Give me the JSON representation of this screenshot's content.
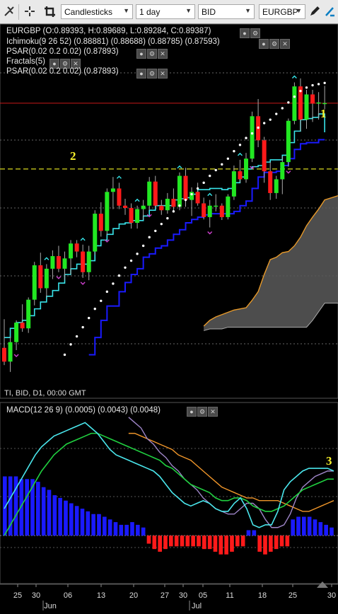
{
  "toolbar": {
    "chart_type": "Candlesticks",
    "period": "1 day",
    "side": "BID",
    "symbol": "EURGBP",
    "icons": [
      "tools-icon",
      "crosshair-icon",
      "crop-icon",
      "pencil-icon",
      "eraser-icon"
    ]
  },
  "legend": {
    "ohlc": "EURGBP (O:0.89393, H:0.89689, L:0.89284, C:0.89387)",
    "ichimoku": "Ichimoku(9 26 52) (0.88881) (0.88688) (0.88785) (0.87593)",
    "psar1": "PSAR(0.02 0.2 0.02) (0.87893)",
    "fractals": "Fractals(5)",
    "psar2": "PSAR(0.02 0.2 0.02) (0.87893)"
  },
  "footer_label": "TI, BID, D1, 00:00 GMT",
  "macd_label": "MACD(12 26 9) (0.0005) (0.0043) (0.0048)",
  "annotations": [
    "1",
    "2",
    "3"
  ],
  "x_axis": {
    "day_labels": [
      "25",
      "30",
      "06",
      "13",
      "20",
      "27",
      "30",
      "05",
      "11",
      "18",
      "25",
      "30"
    ],
    "month_labels": [
      "Jun",
      "Jul"
    ]
  },
  "colors": {
    "bull": "#22e822",
    "bear": "#ff1a1a",
    "tenkan": "#39e4ea",
    "kijun": "#1a1aff",
    "psar": "#ffffff",
    "cloud": "#5a5a5a",
    "span_b": "#e89a2a",
    "hline": "#c81818",
    "macd": "#4ae6ec",
    "signal": "#20d040",
    "macd_b": "#f0962a",
    "macd_c": "#9f86c9",
    "hist_pos": "#1a1aff",
    "hist_neg": "#ff1a1a"
  },
  "chart_data": {
    "type": "candlestick",
    "title": "EURGBP",
    "price_range": [
      0.845,
      0.902
    ],
    "candles": [
      [
        0.8512,
        0.8562,
        0.8482,
        0.8488
      ],
      [
        0.8488,
        0.8532,
        0.847,
        0.8522
      ],
      [
        0.8522,
        0.856,
        0.8508,
        0.8556
      ],
      [
        0.8556,
        0.8588,
        0.854,
        0.8546
      ],
      [
        0.8546,
        0.86,
        0.8538,
        0.8596
      ],
      [
        0.8596,
        0.8662,
        0.8586,
        0.8656
      ],
      [
        0.8656,
        0.8678,
        0.8608,
        0.8616
      ],
      [
        0.8616,
        0.8658,
        0.86,
        0.865
      ],
      [
        0.865,
        0.8682,
        0.8632,
        0.8672
      ],
      [
        0.8672,
        0.869,
        0.8644,
        0.865
      ],
      [
        0.865,
        0.868,
        0.863,
        0.8668
      ],
      [
        0.8668,
        0.87,
        0.864,
        0.8694
      ],
      [
        0.8694,
        0.87,
        0.867,
        0.868
      ],
      [
        0.868,
        0.8692,
        0.8634,
        0.8644
      ],
      [
        0.8644,
        0.869,
        0.863,
        0.868
      ],
      [
        0.868,
        0.8752,
        0.8674,
        0.8746
      ],
      [
        0.8746,
        0.8766,
        0.8706,
        0.8716
      ],
      [
        0.8716,
        0.879,
        0.8708,
        0.8784
      ],
      [
        0.8784,
        0.881,
        0.8754,
        0.879
      ],
      [
        0.879,
        0.88,
        0.8754,
        0.876
      ],
      [
        0.876,
        0.8772,
        0.8744,
        0.8756
      ],
      [
        0.8756,
        0.8764,
        0.872,
        0.873
      ],
      [
        0.873,
        0.876,
        0.872,
        0.8754
      ],
      [
        0.8754,
        0.877,
        0.8736,
        0.876
      ],
      [
        0.876,
        0.881,
        0.8752,
        0.8802
      ],
      [
        0.8802,
        0.8812,
        0.8756,
        0.876
      ],
      [
        0.876,
        0.877,
        0.8744,
        0.8752
      ],
      [
        0.8752,
        0.8782,
        0.8746,
        0.8772
      ],
      [
        0.8772,
        0.879,
        0.875,
        0.8758
      ],
      [
        0.8758,
        0.8818,
        0.8752,
        0.8812
      ],
      [
        0.8812,
        0.8826,
        0.8758,
        0.877
      ],
      [
        0.877,
        0.8792,
        0.8742,
        0.8784
      ],
      [
        0.8784,
        0.88,
        0.876,
        0.8764
      ],
      [
        0.8764,
        0.8774,
        0.8736,
        0.874
      ],
      [
        0.874,
        0.877,
        0.8722,
        0.876
      ],
      [
        0.876,
        0.878,
        0.875,
        0.876
      ],
      [
        0.876,
        0.8764,
        0.8735,
        0.874
      ],
      [
        0.874,
        0.878,
        0.8736,
        0.8776
      ],
      [
        0.8776,
        0.883,
        0.877,
        0.882
      ],
      [
        0.882,
        0.884,
        0.88,
        0.8806
      ],
      [
        0.8806,
        0.8852,
        0.88,
        0.8842
      ],
      [
        0.8842,
        0.8924,
        0.8836,
        0.8916
      ],
      [
        0.8916,
        0.8946,
        0.8862,
        0.8874
      ],
      [
        0.8874,
        0.888,
        0.88,
        0.882
      ],
      [
        0.882,
        0.8836,
        0.877,
        0.8782
      ],
      [
        0.8782,
        0.8812,
        0.8772,
        0.8806
      ],
      [
        0.8806,
        0.8846,
        0.878,
        0.8836
      ],
      [
        0.8836,
        0.8912,
        0.8828,
        0.8908
      ],
      [
        0.8908,
        0.8975,
        0.8902,
        0.8968
      ],
      [
        0.8968,
        0.8982,
        0.889,
        0.891
      ],
      [
        0.891,
        0.8962,
        0.8894,
        0.8954
      ],
      [
        0.8954,
        0.8962,
        0.8906,
        0.8938
      ],
      [
        0.8938,
        0.8958,
        0.891,
        0.894
      ],
      [
        0.8939,
        0.8969,
        0.8928,
        0.8939
      ]
    ],
    "tenkan": [
      0.853,
      0.8546,
      0.8556,
      0.856,
      0.8568,
      0.858,
      0.8592,
      0.8602,
      0.8612,
      0.8625,
      0.864,
      0.865,
      0.8658,
      0.8658,
      0.8664,
      0.869,
      0.87,
      0.871,
      0.872,
      0.8728,
      0.873,
      0.8734,
      0.8734,
      0.8742,
      0.8752,
      0.876,
      0.876,
      0.876,
      0.877,
      0.8772,
      0.8774,
      0.878,
      0.8788,
      0.8788,
      0.879,
      0.879,
      0.8788,
      0.879,
      0.88,
      0.881,
      0.8824,
      0.8828,
      0.883,
      0.8836,
      0.884,
      0.884,
      0.8848,
      0.887,
      0.889,
      0.891,
      0.8912,
      0.8914,
      0.892,
      0.8888
    ],
    "kijun": [
      null,
      null,
      null,
      null,
      null,
      null,
      null,
      null,
      null,
      null,
      null,
      null,
      null,
      null,
      0.85,
      0.853,
      0.856,
      0.8585,
      0.8585,
      0.861,
      0.8626,
      0.864,
      0.865,
      0.867,
      0.8676,
      0.8686,
      0.869,
      0.87,
      0.871,
      0.8718,
      0.873,
      0.8736,
      0.874,
      0.8744,
      0.8746,
      0.8746,
      0.8746,
      0.8746,
      0.875,
      0.876,
      0.8768,
      0.879,
      0.881,
      0.8818,
      0.8818,
      0.882,
      0.883,
      0.8842,
      0.8858,
      0.8868,
      0.887,
      0.887,
      0.8875,
      0.8875
    ],
    "psar": [
      null,
      null,
      null,
      null,
      null,
      null,
      null,
      null,
      null,
      null,
      0.85,
      0.8518,
      0.8532,
      0.8548,
      0.8564,
      0.858,
      0.8594,
      0.861,
      0.8624,
      0.8638,
      0.8652,
      0.8664,
      0.8676,
      0.869,
      0.8705,
      0.8716,
      0.8728,
      0.8738,
      0.875,
      0.876,
      0.877,
      0.878,
      0.879,
      0.88,
      0.8812,
      0.8822,
      0.8832,
      0.8842,
      0.8855,
      0.8866,
      0.8878,
      0.8886,
      0.8896,
      0.8904,
      0.891,
      0.892,
      0.893,
      0.894,
      0.895,
      0.896,
      0.8966,
      0.897,
      0.8972,
      0.8974
    ],
    "cloud_top": [
      null,
      null,
      null,
      null,
      null,
      null,
      null,
      null,
      null,
      null,
      null,
      null,
      null,
      null,
      null,
      null,
      null,
      null,
      null,
      null,
      null,
      null,
      null,
      null,
      null,
      null,
      null,
      null,
      null,
      null,
      null,
      null,
      null,
      0.855,
      0.856,
      0.8566,
      0.857,
      0.8574,
      0.8578,
      0.858,
      0.8582,
      0.8595,
      0.861,
      0.864,
      0.8666,
      0.867,
      0.8678,
      0.868,
      0.869,
      0.8705,
      0.8725,
      0.874,
      0.8754,
      0.877
    ],
    "cloud_bottom": [
      null,
      null,
      null,
      null,
      null,
      null,
      null,
      null,
      null,
      null,
      null,
      null,
      null,
      null,
      null,
      null,
      null,
      null,
      null,
      null,
      null,
      null,
      null,
      null,
      null,
      null,
      null,
      null,
      null,
      null,
      null,
      null,
      null,
      0.8542,
      0.8545,
      0.8545,
      0.8545,
      0.8548,
      0.8548,
      0.8548,
      0.8548,
      0.8548,
      0.8548,
      0.8548,
      0.8548,
      0.8548,
      0.8548,
      0.8548,
      0.8548,
      0.8548,
      0.8548,
      0.856,
      0.8575,
      0.859
    ],
    "fractal_up_index": [
      7,
      13,
      19,
      22,
      29,
      34,
      39,
      48
    ],
    "fractal_down_index": [
      2,
      9,
      13,
      17,
      24,
      34,
      41,
      47
    ],
    "close_line": 0.89387,
    "dashed_level": 0.8824,
    "macd_range": [
      -0.0016,
      0.0045
    ],
    "macd": [
      0.001,
      0.0014,
      0.0018,
      0.0022,
      0.0026,
      0.003,
      0.0033,
      0.0035,
      0.0037,
      0.0038,
      0.0039,
      0.004,
      0.0041,
      0.0042,
      0.004,
      0.0038,
      0.0035,
      0.0032,
      0.003,
      0.0029,
      0.0028,
      0.0027,
      0.0026,
      0.0025,
      0.0024,
      0.0022,
      0.0019,
      0.0016,
      0.0014,
      0.0012,
      0.0011,
      0.0012,
      0.0013,
      0.0012,
      0.001,
      0.0009,
      0.0009,
      0.0012,
      0.0014,
      0.001,
      0.0004,
      0.0003,
      0.0004,
      0.0004,
      0.0009,
      0.0017,
      0.002,
      0.0022,
      0.0024,
      0.0025,
      0.0025,
      0.0025,
      0.0025,
      0.0024
    ],
    "signal": [
      0.0,
      0.0004,
      0.0008,
      0.0012,
      0.0016,
      0.002,
      0.0024,
      0.0027,
      0.003,
      0.0032,
      0.0034,
      0.0035,
      0.0036,
      0.0037,
      0.0038,
      0.0038,
      0.0037,
      0.0036,
      0.0035,
      0.0034,
      0.0033,
      0.0032,
      0.0031,
      0.003,
      0.0029,
      0.0028,
      0.0026,
      0.0025,
      0.0023,
      0.0021,
      0.0019,
      0.0018,
      0.0017,
      0.0016,
      0.0014,
      0.0013,
      0.0013,
      0.0014,
      0.0014,
      0.0013,
      0.0011,
      0.001,
      0.0009,
      0.0009,
      0.001,
      0.0011,
      0.0013,
      0.0015,
      0.0017,
      0.0018,
      0.0019,
      0.002,
      0.0021,
      0.0021
    ],
    "macd_orange": [
      null,
      null,
      null,
      null,
      null,
      null,
      null,
      null,
      null,
      null,
      null,
      null,
      null,
      null,
      null,
      null,
      null,
      null,
      null,
      null,
      0.0038,
      0.0038,
      0.0037,
      0.0036,
      0.0035,
      0.0034,
      0.0033,
      0.0032,
      0.003,
      0.0029,
      0.0028,
      0.0026,
      0.0024,
      0.0022,
      0.002,
      0.0018,
      0.0017,
      0.0016,
      0.0015,
      0.0014,
      0.0014,
      0.0013,
      0.0013,
      0.0013,
      0.0013,
      0.0012,
      0.0011,
      0.001,
      0.0009,
      0.0009,
      0.001,
      0.0011,
      0.0012,
      0.0013
    ],
    "macd_purple": [
      null,
      null,
      null,
      null,
      null,
      null,
      null,
      null,
      null,
      null,
      null,
      null,
      null,
      null,
      null,
      null,
      null,
      null,
      null,
      null,
      0.0044,
      0.0042,
      0.004,
      0.0036,
      0.0034,
      0.0031,
      0.0029,
      0.0026,
      0.0024,
      0.0021,
      0.0019,
      0.0017,
      0.0014,
      0.0012,
      0.001,
      0.0009,
      0.0008,
      0.0008,
      0.001,
      0.0012,
      0.0012,
      0.001,
      0.0006,
      0.0003,
      0.0003,
      0.0004,
      0.0008,
      0.0014,
      0.0018,
      0.002,
      0.0022,
      0.0023,
      0.0024,
      0.0024
    ],
    "histogram": [
      0.0022,
      0.0022,
      0.0022,
      0.0021,
      0.0021,
      0.0021,
      0.002,
      0.0018,
      0.0017,
      0.0015,
      0.0014,
      0.0013,
      0.0012,
      0.0011,
      0.001,
      0.0009,
      0.0008,
      0.0008,
      0.0007,
      0.0006,
      0.0005,
      0.0004,
      0.0004,
      0.0005,
      0.0004,
      0.0003,
      -0.0003,
      -0.0005,
      -0.0006,
      -0.0005,
      -0.0004,
      -0.0004,
      -0.0004,
      -0.0004,
      -0.0004,
      -0.0004,
      -0.0005,
      -0.0005,
      -0.0006,
      -0.0007,
      -0.0007,
      -0.0006,
      -0.0004,
      -0.0004,
      0.0002,
      0.0002,
      -0.0006,
      -0.0007,
      -0.0006,
      -0.0005,
      -0.0004,
      -0.0004,
      0.0006,
      0.0007,
      0.0007,
      0.0007,
      0.0006,
      0.0005,
      0.0004,
      0.0003
    ]
  }
}
